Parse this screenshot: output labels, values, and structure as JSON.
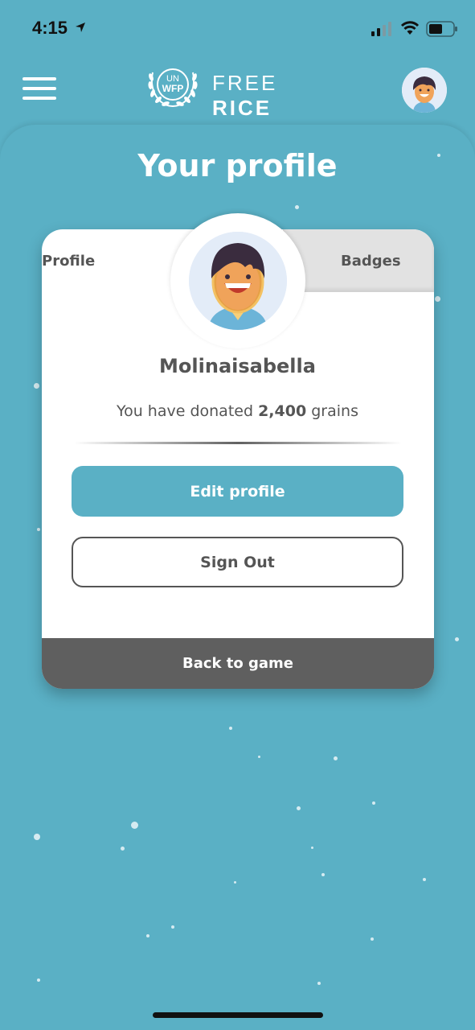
{
  "status_bar": {
    "time": "4:15"
  },
  "header": {
    "logo_emblem_top": "UN",
    "logo_emblem_bottom": "WFP",
    "logo_free": "FREE",
    "logo_rice": "RICE"
  },
  "page": {
    "title": "Your profile"
  },
  "tabs": {
    "profile": "Profile",
    "badges": "Badges"
  },
  "profile": {
    "username": "Molinaisabella",
    "donated_prefix": "You have donated",
    "donated_amount": "2,400",
    "donated_suffix": "grains"
  },
  "buttons": {
    "edit_profile": "Edit profile",
    "sign_out": "Sign Out",
    "back_to_game": "Back to game"
  },
  "colors": {
    "background": "#5ab0c5",
    "primary_button": "#5ab0c5",
    "back_bar": "#5f5f5f",
    "text": "#555555"
  }
}
